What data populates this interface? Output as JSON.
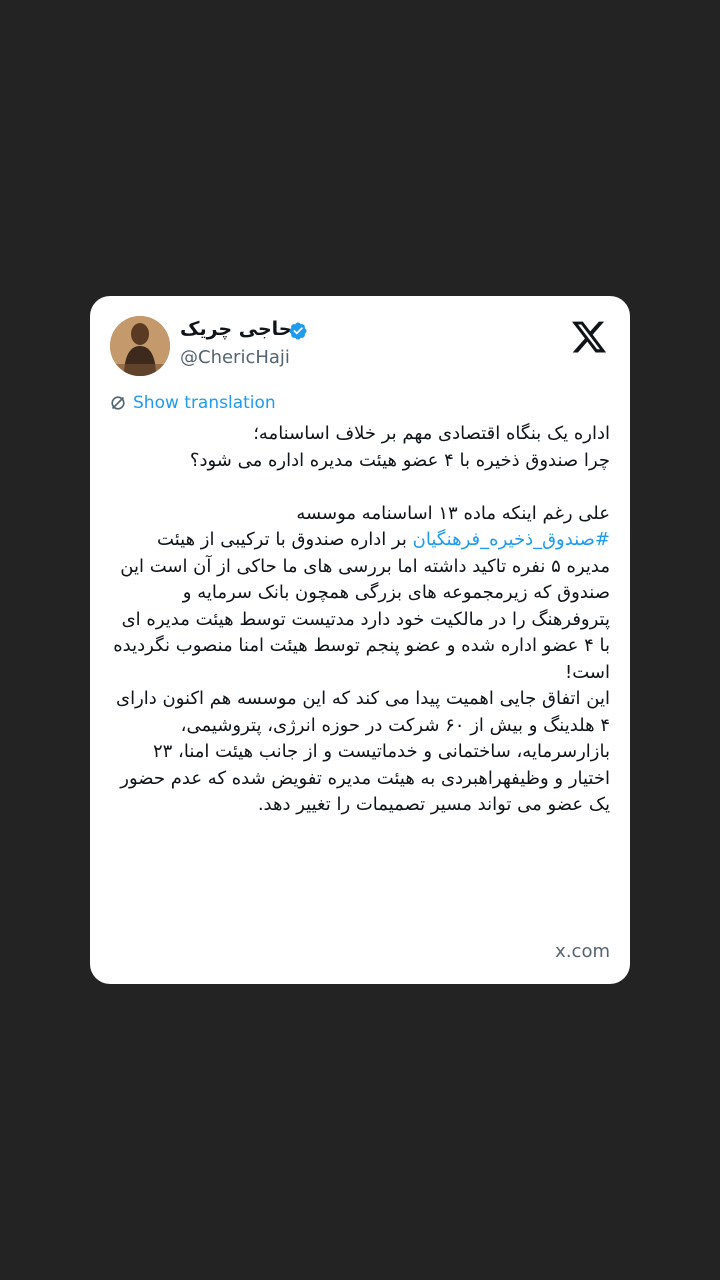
{
  "tweet": {
    "display_name": "حاجی چریک",
    "handle": "@ChericHaji",
    "verified": true,
    "translate_label": "Show translation",
    "paragraph1": "اداره یک بنگاه اقتصادی مهم بر خلاف اساسنامه؛\nچرا صندوق ذخیره با ۴ عضو هیئت مدیره اداره می شود؟",
    "paragraph2_start": "علی رغم اینکه ماده ۱۳ اساسنامه موسسه",
    "hashtag": "#صندوق_ذخیره_فرهنگیان",
    "paragraph2_rest": " بر اداره صندوق با ترکیبی از هیئت مدیره ۵ نفره تاکید داشته اما بررسی های ما حاکی از آن است این صندوق که زیرمجموعه های بزرگی همچون بانک سرمایه و پتروفرهنگ را در مالکیت خود دارد مدتیست توسط هیئت مدیره ای با ۴ عضو اداره شده و عضو پنجم توسط هیئت امنا منصوب نگردیده است!",
    "paragraph3": "این اتفاق جایی اهمیت پیدا می کند که این موسسه هم اکنون دارای ۴ هلدینگ و بیش از ۶۰ شرکت در حوزه انرژی، پتروشیمی، بازارسرمایه، ساختمانی و خدماتیست و از جانب هیئت امنا، ۲۳ اختیار و وظیفهراهبردی به هیئت مدیره تفویض شده که عدم حضور یک عضو می تواند مسیر تصمیمات را تغییر دهد.",
    "source": "x.com"
  },
  "colors": {
    "background": "#232323",
    "card": "#ffffff",
    "text": "#0f1419",
    "secondary": "#536471",
    "link": "#1d9bf0"
  },
  "icons": {
    "brand": "x-logo-icon",
    "verified": "verified-badge-icon",
    "translate": "translate-icon"
  }
}
